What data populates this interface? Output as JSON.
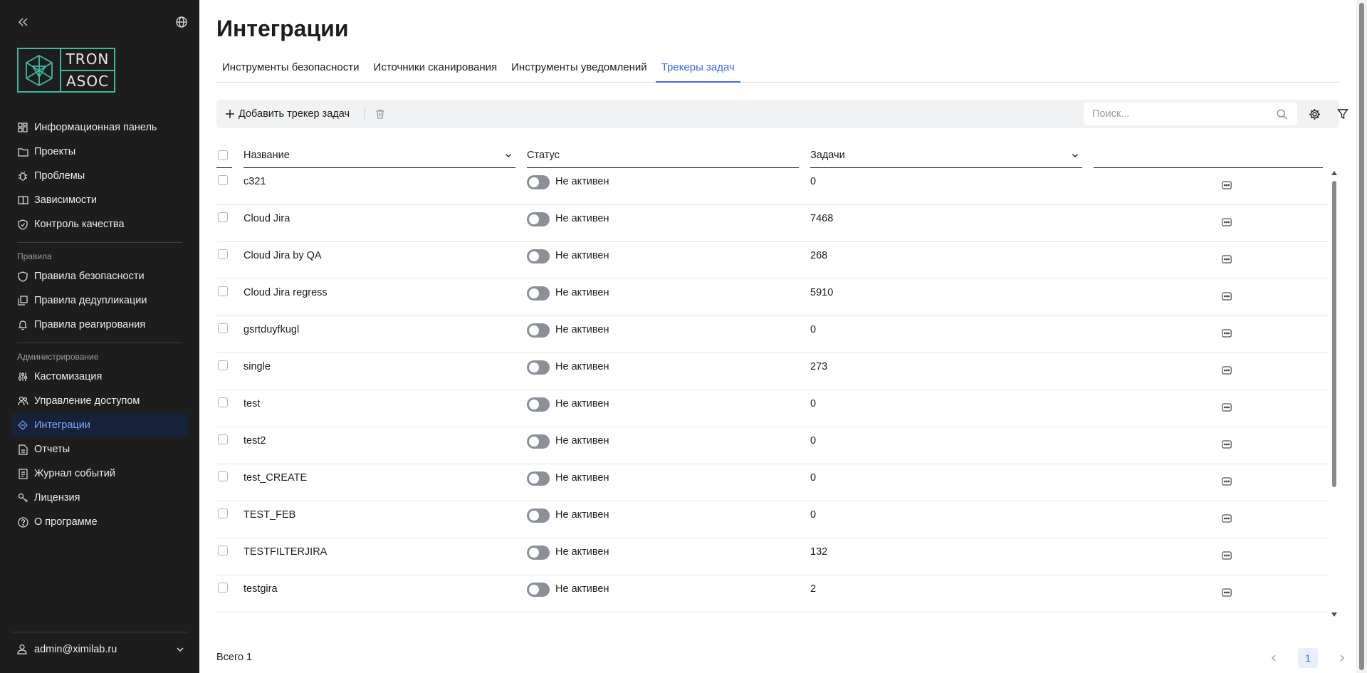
{
  "sidebar": {
    "logo": {
      "line1": "TRON",
      "line2": "ASOC"
    },
    "items_main": [
      {
        "label": "Информационная панель",
        "icon": "dashboard-icon"
      },
      {
        "label": "Проекты",
        "icon": "folder-icon"
      },
      {
        "label": "Проблемы",
        "icon": "bug-icon"
      },
      {
        "label": "Зависимости",
        "icon": "book-icon"
      },
      {
        "label": "Контроль качества",
        "icon": "shield-check-icon"
      }
    ],
    "group_rules": "Правила",
    "items_rules": [
      {
        "label": "Правила безопасности",
        "icon": "shield-icon"
      },
      {
        "label": "Правила дедупликации",
        "icon": "copy-icon"
      },
      {
        "label": "Правила реагирования",
        "icon": "bell-icon"
      }
    ],
    "group_admin": "Администрирование",
    "items_admin": [
      {
        "label": "Кастомизация",
        "icon": "sliders-icon"
      },
      {
        "label": "Управление доступом",
        "icon": "users-icon"
      },
      {
        "label": "Интеграции",
        "icon": "integration-icon",
        "active": true
      },
      {
        "label": "Отчеты",
        "icon": "report-icon"
      },
      {
        "label": "Журнал событий",
        "icon": "log-icon"
      },
      {
        "label": "Лицензия",
        "icon": "key-icon"
      },
      {
        "label": "О программе",
        "icon": "help-icon"
      }
    ],
    "user": "admin@ximilab.ru"
  },
  "page": {
    "title": "Интеграции",
    "tabs": [
      "Инструменты безопасности",
      "Источники сканирования",
      "Инструменты уведомлений",
      "Трекеры задач"
    ],
    "active_tab": 3
  },
  "toolbar": {
    "add_label": "Добавить трекер задач",
    "search_placeholder": "Поиск..."
  },
  "table": {
    "columns": {
      "name": "Название",
      "status": "Статус",
      "tasks": "Задачи"
    },
    "rows": [
      {
        "name": "c321",
        "status": "Не активен",
        "tasks": "0"
      },
      {
        "name": "Cloud Jira",
        "status": "Не активен",
        "tasks": "7468"
      },
      {
        "name": "Cloud Jira by QA",
        "status": "Не активен",
        "tasks": "268"
      },
      {
        "name": "Cloud Jira regress",
        "status": "Не активен",
        "tasks": "5910"
      },
      {
        "name": "gsrtduyfkugl",
        "status": "Не активен",
        "tasks": "0"
      },
      {
        "name": "single",
        "status": "Не активен",
        "tasks": "273"
      },
      {
        "name": "test",
        "status": "Не активен",
        "tasks": "0"
      },
      {
        "name": "test2",
        "status": "Не активен",
        "tasks": "0"
      },
      {
        "name": "test_CREATE",
        "status": "Не активен",
        "tasks": "0"
      },
      {
        "name": "TEST_FEB",
        "status": "Не активен",
        "tasks": "0"
      },
      {
        "name": "TESTFILTERJIRA",
        "status": "Не активен",
        "tasks": "132"
      },
      {
        "name": "testgira",
        "status": "Не активен",
        "tasks": "2"
      }
    ]
  },
  "footer": {
    "total": "Всего 1",
    "current_page": "1"
  },
  "colors": {
    "accent": "#3c6ae0",
    "sidebar_bg": "#1d1d1d",
    "logo": "#3fb89f"
  }
}
